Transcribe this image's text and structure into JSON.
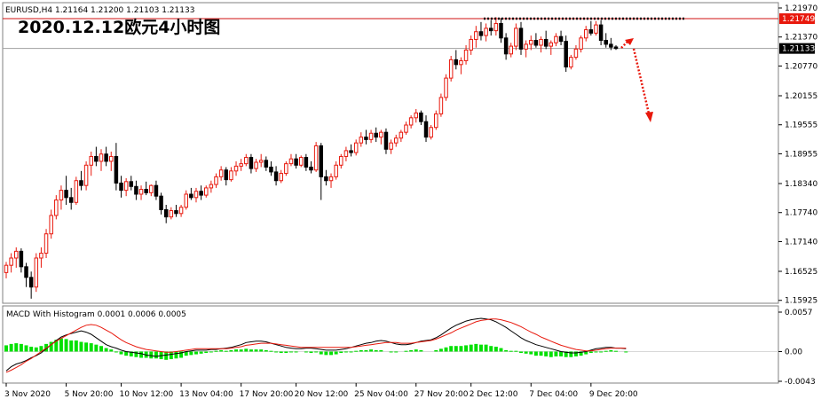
{
  "header": {
    "symbol_line": "EURUSD,H4  1.21164 1.21200 1.21103 1.21133",
    "title": "2020.12.12欧元4小时图"
  },
  "macd_header": "MACD With Histogram  0.0001 0.0006 0.0005",
  "colors": {
    "bull": "#e8180c",
    "bear": "#000000",
    "grid_line": "#c0c0c0",
    "resistance_line": "#d01010",
    "bid_line": "#a0a0a0",
    "price_badge_red": "#e8180c",
    "price_badge_black": "#000000",
    "histogram": "#00e000",
    "macd_line": "#000000",
    "signal_line": "#e8180c",
    "arrow": "#e8180c",
    "dotted_line": "#000000"
  },
  "chart_data": [
    {
      "type": "candlestick",
      "symbol": "EURUSD",
      "timeframe": "H4",
      "ylim": [
        1.1592,
        1.2197
      ],
      "y_ticks": [
        "1.21970",
        "1.21370",
        "1.20770",
        "1.20155",
        "1.19555",
        "1.18955",
        "1.18340",
        "1.17740",
        "1.17140",
        "1.16525",
        "1.15925"
      ],
      "price_labels": [
        {
          "text": "1.21749",
          "value": 1.21749,
          "style": "red"
        },
        {
          "text": "1.21133",
          "value": 1.21133,
          "style": "black"
        }
      ],
      "x_tick_labels": [
        "3 Nov 2020",
        "5 Nov 20:00",
        "10 Nov 12:00",
        "13 Nov 04:00",
        "17 Nov 20:00",
        "20 Nov 12:00",
        "25 Nov 04:00",
        "27 Nov 20:00",
        "2 Dec 12:00",
        "7 Dec 04:00",
        "9 Dec 20:00"
      ],
      "candles": [
        [
          1.165,
          1.1672,
          1.1638,
          1.1665
        ],
        [
          1.1665,
          1.169,
          1.165,
          1.168
        ],
        [
          1.168,
          1.1702,
          1.166,
          1.1694
        ],
        [
          1.1694,
          1.17,
          1.165,
          1.1662
        ],
        [
          1.1662,
          1.167,
          1.162,
          1.164
        ],
        [
          1.164,
          1.1652,
          1.1596,
          1.162
        ],
        [
          1.162,
          1.169,
          1.161,
          1.168
        ],
        [
          1.168,
          1.1702,
          1.166,
          1.169
        ],
        [
          1.169,
          1.174,
          1.168,
          1.173
        ],
        [
          1.173,
          1.178,
          1.172,
          1.1768
        ],
        [
          1.1768,
          1.181,
          1.176,
          1.18
        ],
        [
          1.18,
          1.183,
          1.178,
          1.182
        ],
        [
          1.182,
          1.185,
          1.179,
          1.1805
        ],
        [
          1.1805,
          1.1825,
          1.178,
          1.1795
        ],
        [
          1.1795,
          1.1848,
          1.179,
          1.184
        ],
        [
          1.184,
          1.186,
          1.182,
          1.183
        ],
        [
          1.183,
          1.188,
          1.182,
          1.1872
        ],
        [
          1.1872,
          1.19,
          1.185,
          1.189
        ],
        [
          1.189,
          1.191,
          1.187,
          1.188
        ],
        [
          1.188,
          1.1905,
          1.186,
          1.1895
        ],
        [
          1.1895,
          1.191,
          1.187,
          1.188
        ],
        [
          1.188,
          1.19,
          1.186,
          1.189
        ],
        [
          1.189,
          1.1918,
          1.182,
          1.1835
        ],
        [
          1.1835,
          1.185,
          1.1805,
          1.182
        ],
        [
          1.182,
          1.1845,
          1.1808,
          1.1838
        ],
        [
          1.1838,
          1.185,
          1.182,
          1.1828
        ],
        [
          1.1828,
          1.184,
          1.18,
          1.1812
        ],
        [
          1.1812,
          1.183,
          1.18,
          1.1822
        ],
        [
          1.1822,
          1.1838,
          1.181,
          1.1815
        ],
        [
          1.1815,
          1.1832,
          1.1808,
          1.183
        ],
        [
          1.183,
          1.184,
          1.18,
          1.1808
        ],
        [
          1.1808,
          1.1815,
          1.177,
          1.178
        ],
        [
          1.178,
          1.179,
          1.1752,
          1.1765
        ],
        [
          1.1765,
          1.1785,
          1.176,
          1.1778
        ],
        [
          1.1778,
          1.179,
          1.1765,
          1.1772
        ],
        [
          1.1772,
          1.179,
          1.1765,
          1.1785
        ],
        [
          1.1785,
          1.182,
          1.178,
          1.1812
        ],
        [
          1.1812,
          1.1825,
          1.18,
          1.1805
        ],
        [
          1.1805,
          1.1825,
          1.1795,
          1.1818
        ],
        [
          1.1818,
          1.183,
          1.18,
          1.181
        ],
        [
          1.181,
          1.183,
          1.1805,
          1.1825
        ],
        [
          1.1825,
          1.184,
          1.1815,
          1.1832
        ],
        [
          1.1832,
          1.1855,
          1.1825,
          1.1848
        ],
        [
          1.1848,
          1.187,
          1.184,
          1.1862
        ],
        [
          1.1862,
          1.1868,
          1.183,
          1.1842
        ],
        [
          1.1842,
          1.1868,
          1.1838,
          1.186
        ],
        [
          1.186,
          1.188,
          1.185,
          1.187
        ],
        [
          1.187,
          1.1885,
          1.186,
          1.1875
        ],
        [
          1.1875,
          1.1895,
          1.187,
          1.1888
        ],
        [
          1.1888,
          1.1895,
          1.1855,
          1.1865
        ],
        [
          1.1865,
          1.1885,
          1.1858,
          1.1878
        ],
        [
          1.1878,
          1.1895,
          1.1868,
          1.1882
        ],
        [
          1.1882,
          1.189,
          1.186,
          1.1868
        ],
        [
          1.1868,
          1.188,
          1.185,
          1.1858
        ],
        [
          1.1858,
          1.187,
          1.183,
          1.184
        ],
        [
          1.184,
          1.1862,
          1.1835,
          1.1855
        ],
        [
          1.1855,
          1.188,
          1.185,
          1.1875
        ],
        [
          1.1875,
          1.1895,
          1.187,
          1.1885
        ],
        [
          1.1885,
          1.1895,
          1.1865,
          1.1872
        ],
        [
          1.1872,
          1.1892,
          1.1868,
          1.1888
        ],
        [
          1.1888,
          1.1895,
          1.186,
          1.1868
        ],
        [
          1.1868,
          1.188,
          1.1855,
          1.1862
        ],
        [
          1.1862,
          1.192,
          1.1858,
          1.1912
        ],
        [
          1.1912,
          1.1918,
          1.18,
          1.1848
        ],
        [
          1.1848,
          1.1862,
          1.183,
          1.184
        ],
        [
          1.184,
          1.1855,
          1.1825,
          1.1848
        ],
        [
          1.1848,
          1.188,
          1.1842,
          1.1872
        ],
        [
          1.1872,
          1.1895,
          1.1865,
          1.189
        ],
        [
          1.189,
          1.191,
          1.188,
          1.1902
        ],
        [
          1.1902,
          1.1915,
          1.189,
          1.1898
        ],
        [
          1.1898,
          1.1925,
          1.1892,
          1.1918
        ],
        [
          1.1918,
          1.194,
          1.191,
          1.193
        ],
        [
          1.193,
          1.1945,
          1.1915,
          1.1925
        ],
        [
          1.1925,
          1.1945,
          1.1918,
          1.1938
        ],
        [
          1.1938,
          1.195,
          1.192,
          1.193
        ],
        [
          1.193,
          1.1945,
          1.1915,
          1.194
        ],
        [
          1.194,
          1.1948,
          1.1895,
          1.1905
        ],
        [
          1.1905,
          1.1925,
          1.1895,
          1.1918
        ],
        [
          1.1918,
          1.1935,
          1.191,
          1.1928
        ],
        [
          1.1928,
          1.1945,
          1.192,
          1.194
        ],
        [
          1.194,
          1.1962,
          1.1935,
          1.1955
        ],
        [
          1.1955,
          1.1975,
          1.1948,
          1.197
        ],
        [
          1.197,
          1.1988,
          1.196,
          1.198
        ],
        [
          1.198,
          1.1985,
          1.1955,
          1.1962
        ],
        [
          1.1962,
          1.1975,
          1.192,
          1.193
        ],
        [
          1.193,
          1.1955,
          1.1925,
          1.195
        ],
        [
          1.195,
          1.1985,
          1.1945,
          1.1978
        ],
        [
          1.1978,
          1.202,
          1.1972,
          1.2012
        ],
        [
          1.2012,
          1.206,
          1.2005,
          1.2052
        ],
        [
          1.2052,
          1.2098,
          1.2045,
          1.209
        ],
        [
          1.209,
          1.211,
          1.207,
          1.208
        ],
        [
          1.208,
          1.2095,
          1.206,
          1.2088
        ],
        [
          1.2088,
          1.212,
          1.208,
          1.211
        ],
        [
          1.211,
          1.214,
          1.21,
          1.2132
        ],
        [
          1.2132,
          1.216,
          1.2115,
          1.2148
        ],
        [
          1.2148,
          1.2168,
          1.213,
          1.214
        ],
        [
          1.214,
          1.2165,
          1.2128,
          1.2155
        ],
        [
          1.2155,
          1.2172,
          1.214,
          1.215
        ],
        [
          1.215,
          1.2178,
          1.214,
          1.2165
        ],
        [
          1.2165,
          1.2176,
          1.2125,
          1.2135
        ],
        [
          1.2135,
          1.2145,
          1.209,
          1.2102
        ],
        [
          1.2102,
          1.2125,
          1.2095,
          1.2118
        ],
        [
          1.2118,
          1.2165,
          1.211,
          1.2155
        ],
        [
          1.2155,
          1.2168,
          1.21,
          1.2112
        ],
        [
          1.2112,
          1.213,
          1.2095,
          1.2122
        ],
        [
          1.2122,
          1.214,
          1.211,
          1.213
        ],
        [
          1.213,
          1.2145,
          1.2115,
          1.212
        ],
        [
          1.212,
          1.2138,
          1.2105,
          1.2132
        ],
        [
          1.2132,
          1.215,
          1.2112,
          1.2118
        ],
        [
          1.2118,
          1.213,
          1.21,
          1.2125
        ],
        [
          1.2125,
          1.2145,
          1.2118,
          1.2138
        ],
        [
          1.2138,
          1.215,
          1.212,
          1.2128
        ],
        [
          1.2128,
          1.214,
          1.2065,
          1.2075
        ],
        [
          1.2075,
          1.21,
          1.207,
          1.2095
        ],
        [
          1.2095,
          1.212,
          1.209,
          1.2112
        ],
        [
          1.2112,
          1.214,
          1.2105,
          1.2135
        ],
        [
          1.2135,
          1.216,
          1.2128,
          1.2152
        ],
        [
          1.2152,
          1.217,
          1.214,
          1.2145
        ],
        [
          1.2145,
          1.217,
          1.214,
          1.2162
        ],
        [
          1.2162,
          1.2172,
          1.212,
          1.213
        ],
        [
          1.213,
          1.2145,
          1.2115,
          1.2122
        ],
        [
          1.2122,
          1.2135,
          1.211,
          1.2116
        ],
        [
          1.21164,
          1.212,
          1.21103,
          1.21133
        ]
      ]
    },
    {
      "type": "macd",
      "name": "MACD With Histogram",
      "values_shown": [
        0.0001,
        0.0006,
        0.0005
      ],
      "ylim": [
        -0.0043,
        0.0057
      ],
      "y_ticks": [
        "0.0057",
        "0.00",
        "-0.0043"
      ],
      "histogram": [
        0.0009,
        0.0011,
        0.0012,
        0.0011,
        0.0009,
        0.0007,
        0.0006,
        0.0008,
        0.0011,
        0.0014,
        0.0017,
        0.0019,
        0.0018,
        0.0016,
        0.0016,
        0.0014,
        0.0013,
        0.0012,
        0.001,
        0.0008,
        0.0005,
        0.0003,
        -0.0001,
        -0.0004,
        -0.0006,
        -0.0007,
        -0.0008,
        -0.0009,
        -0.0009,
        -0.001,
        -0.001,
        -0.0011,
        -0.0012,
        -0.0011,
        -0.001,
        -0.0009,
        -0.0006,
        -0.0005,
        -0.0004,
        -0.0003,
        -0.0002,
        -0.0001,
        0.0001,
        0.0002,
        0.0001,
        0.0002,
        0.0003,
        0.0003,
        0.0004,
        0.0003,
        0.0003,
        0.0003,
        0.0002,
        0.0001,
        -0.0001,
        -0.0002,
        -0.0002,
        -0.0001,
        -0.0001,
        0.0,
        -0.0001,
        -0.0002,
        -0.0001,
        -0.0004,
        -0.0005,
        -0.0005,
        -0.0004,
        -0.0002,
        -0.0001,
        -0.0001,
        0.0001,
        0.0002,
        0.0002,
        0.0003,
        0.0002,
        0.0002,
        0.0,
        -0.0001,
        -0.0001,
        0.0,
        0.0001,
        0.0002,
        0.0003,
        0.0002,
        0.0,
        0.0,
        0.0002,
        0.0004,
        0.0006,
        0.0008,
        0.0008,
        0.0008,
        0.0009,
        0.001,
        0.0011,
        0.001,
        0.001,
        0.0008,
        0.0007,
        0.0005,
        0.0002,
        0.0001,
        0.0001,
        -0.0002,
        -0.0003,
        -0.0004,
        -0.0006,
        -0.0006,
        -0.0007,
        -0.0008,
        -0.0007,
        -0.0007,
        -0.0008,
        -0.0008,
        -0.0007,
        -0.0006,
        -0.0004,
        -0.0002,
        -0.0001,
        -0.0001,
        0.0001,
        0.0002,
        0.0001,
        0.0,
        -0.0001
      ],
      "macd": [
        -0.0028,
        -0.0022,
        -0.0018,
        -0.0016,
        -0.0013,
        -0.0009,
        -0.0006,
        -0.0002,
        0.0004,
        0.001,
        0.0016,
        0.0021,
        0.0024,
        0.0026,
        0.0028,
        0.003,
        0.0028,
        0.0025,
        0.002,
        0.0015,
        0.001,
        0.0007,
        0.0005,
        0.0002,
        0.0,
        -0.0001,
        -0.0002,
        -0.0003,
        -0.0005,
        -0.0006,
        -0.0007,
        -0.0006,
        -0.0005,
        -0.0004,
        -0.0003,
        -0.0002,
        0.0,
        0.0001,
        0.0002,
        0.0002,
        0.0002,
        0.0003,
        0.0003,
        0.0004,
        0.0005,
        0.0006,
        0.0008,
        0.001,
        0.0013,
        0.0014,
        0.0015,
        0.0015,
        0.0014,
        0.0012,
        0.001,
        0.0008,
        0.0006,
        0.0005,
        0.0004,
        0.0004,
        0.0005,
        0.0005,
        0.0004,
        0.0003,
        0.0002,
        0.0002,
        0.0002,
        0.0003,
        0.0004,
        0.0006,
        0.0008,
        0.001,
        0.0012,
        0.0013,
        0.0015,
        0.0016,
        0.0015,
        0.0013,
        0.0011,
        0.001,
        0.001,
        0.0011,
        0.0013,
        0.0015,
        0.0016,
        0.0017,
        0.002,
        0.0024,
        0.0029,
        0.0034,
        0.0038,
        0.0041,
        0.0044,
        0.0046,
        0.0047,
        0.0048,
        0.0047,
        0.0046,
        0.0043,
        0.0039,
        0.0035,
        0.003,
        0.0025,
        0.002,
        0.0016,
        0.0013,
        0.001,
        0.0008,
        0.0006,
        0.0004,
        0.0002,
        0.0,
        -0.0001,
        -0.0002,
        -0.0002,
        -0.0001,
        0.0,
        0.0002,
        0.0004,
        0.0005,
        0.0006,
        0.0006,
        0.0005,
        0.0005,
        0.0004
      ],
      "signal": [
        -0.003,
        -0.0027,
        -0.0023,
        -0.0019,
        -0.0014,
        -0.001,
        -0.0005,
        0.0,
        0.0005,
        0.001,
        0.0015,
        0.0019,
        0.0023,
        0.0027,
        0.0031,
        0.0035,
        0.0038,
        0.0039,
        0.0038,
        0.0035,
        0.0031,
        0.0027,
        0.0022,
        0.0017,
        0.0013,
        0.001,
        0.0007,
        0.0005,
        0.0003,
        0.0002,
        0.0001,
        0.0,
        -0.0001,
        -0.0001,
        0.0,
        0.0001,
        0.0002,
        0.0003,
        0.0004,
        0.0004,
        0.0004,
        0.0004,
        0.0004,
        0.0004,
        0.0004,
        0.0005,
        0.0006,
        0.0007,
        0.0009,
        0.001,
        0.0011,
        0.0012,
        0.0012,
        0.0012,
        0.0011,
        0.001,
        0.0009,
        0.0008,
        0.0007,
        0.0006,
        0.0006,
        0.0006,
        0.0006,
        0.0006,
        0.0006,
        0.0006,
        0.0006,
        0.0006,
        0.0006,
        0.0006,
        0.0007,
        0.0008,
        0.0009,
        0.001,
        0.0011,
        0.0012,
        0.0013,
        0.0013,
        0.0013,
        0.0012,
        0.0012,
        0.0012,
        0.0013,
        0.0014,
        0.0015,
        0.0016,
        0.0018,
        0.0021,
        0.0024,
        0.0027,
        0.0031,
        0.0034,
        0.0037,
        0.004,
        0.0043,
        0.0045,
        0.0046,
        0.0047,
        0.0047,
        0.0046,
        0.0044,
        0.0042,
        0.0039,
        0.0036,
        0.0032,
        0.0028,
        0.0025,
        0.0021,
        0.0018,
        0.0015,
        0.0012,
        0.0009,
        0.0007,
        0.0005,
        0.0003,
        0.0002,
        0.0001,
        0.0001,
        0.0002,
        0.0003,
        0.0004,
        0.0005,
        0.0005,
        0.0005,
        0.0005
      ]
    }
  ]
}
